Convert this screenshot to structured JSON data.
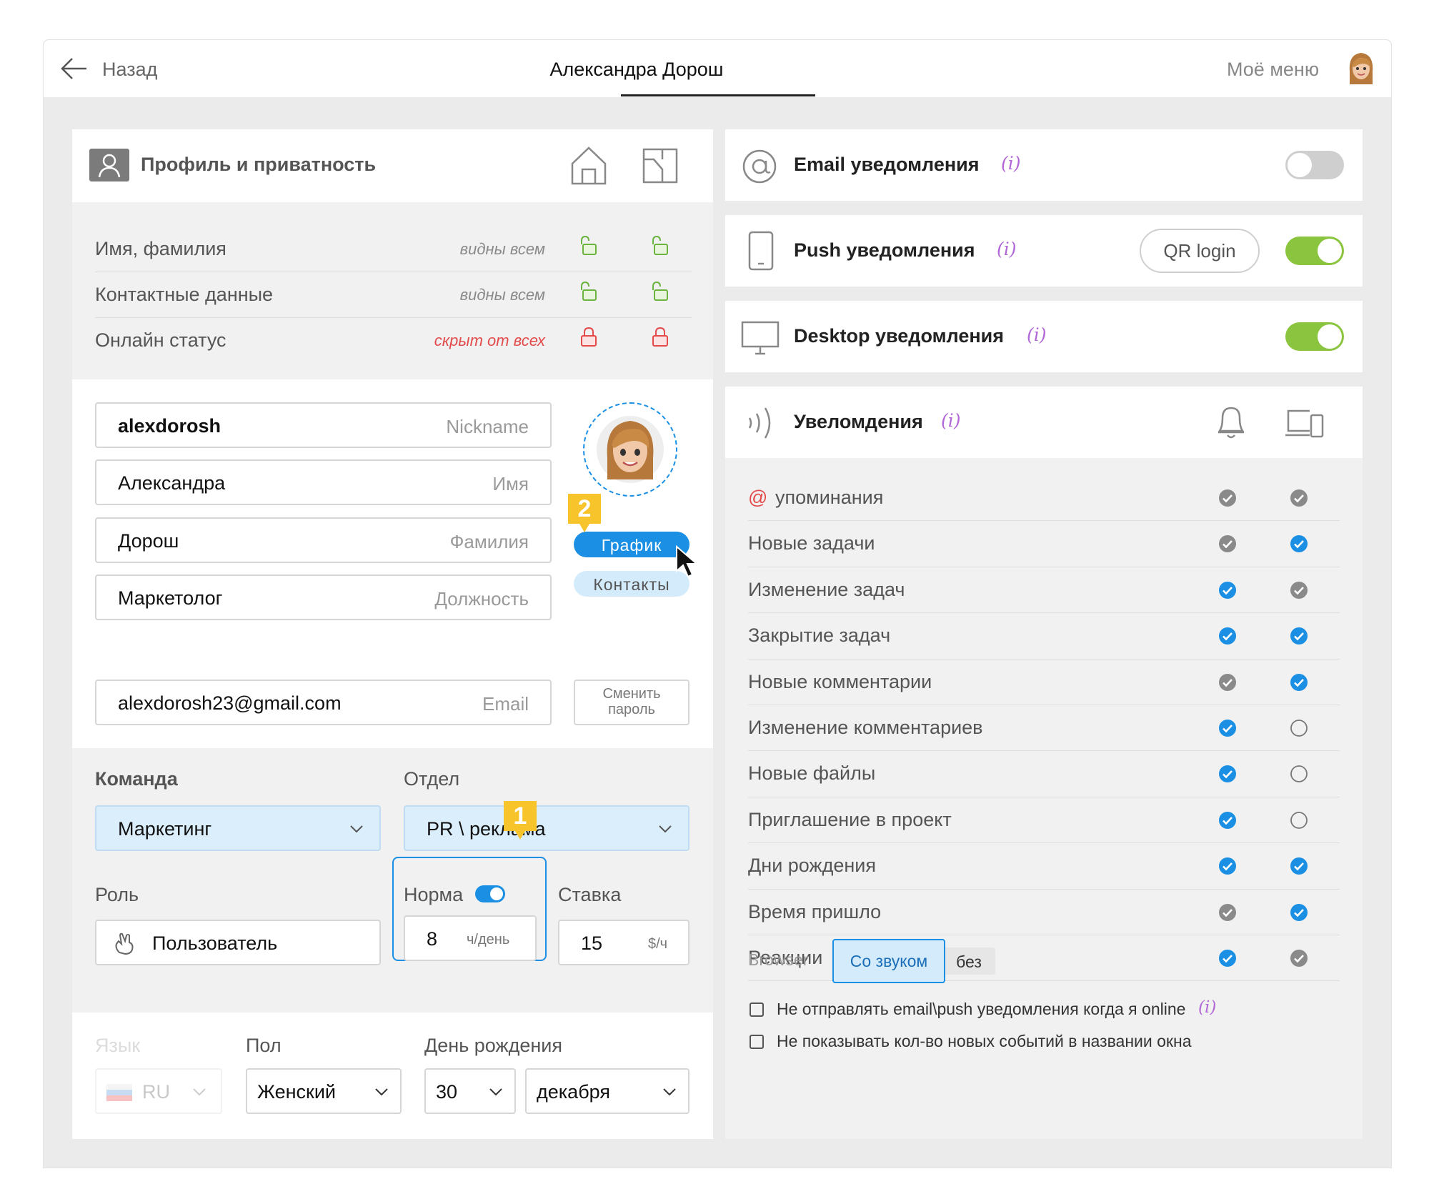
{
  "header": {
    "back_label": "Назад",
    "title": "Александра Дорош",
    "my_menu": "Моё меню"
  },
  "profile": {
    "title": "Профиль и приватность",
    "privacy_rows": [
      {
        "label": "Имя, фамилия",
        "status": "видны всем",
        "locked": false
      },
      {
        "label": "Контактные данные",
        "status": "видны всем",
        "locked": false
      },
      {
        "label": "Онлайн статус",
        "status": "скрыт от всех",
        "locked": true
      }
    ],
    "fields": {
      "nickname": {
        "value": "alexdorosh",
        "placeholder": "Nickname"
      },
      "first_name": {
        "value": "Александра",
        "placeholder": "Имя"
      },
      "last_name": {
        "value": "Дорош",
        "placeholder": "Фамилия"
      },
      "position": {
        "value": "Маркетолог",
        "placeholder": "Должность"
      },
      "email": {
        "value": "alexdorosh23@gmail.com",
        "placeholder": "Email"
      }
    },
    "schedule_label": "График",
    "contacts_label": "Контакты",
    "change_password_line1": "Сменить",
    "change_password_line2": "пароль",
    "badge1": "1",
    "badge2": "2"
  },
  "team": {
    "team_label": "Команда",
    "team_value": "Маркетинг",
    "dept_label": "Отдел",
    "dept_value": "PR \\ реклама",
    "role_label": "Роль",
    "role_value": "Пользователь",
    "norm_label": "Норма",
    "norm_on": true,
    "norm_value": "8",
    "norm_unit": "ч/день",
    "rate_label": "Ставка",
    "rate_value": "15",
    "rate_unit": "$/ч"
  },
  "personal": {
    "lang_label": "Язык",
    "lang_value": "RU",
    "gender_label": "Пол",
    "gender_value": "Женский",
    "birthday_label": "День рождения",
    "birthday_day": "30",
    "birthday_month": "декабря"
  },
  "channels": [
    {
      "title": "Email уведомления",
      "info": "(i)",
      "enabled": false
    },
    {
      "title": "Push уведомления",
      "info": "(i)",
      "enabled": true,
      "button": "QR login"
    },
    {
      "title": "Desktop уведомления",
      "info": "(i)",
      "enabled": true
    }
  ],
  "notifications": {
    "title": "Увеломдения",
    "info": "(i)",
    "rows": [
      {
        "label": "упоминания",
        "prefix": "@",
        "col1": "gray",
        "col2": "gray"
      },
      {
        "label": "Новые задачи",
        "col1": "gray",
        "col2": "blue"
      },
      {
        "label": "Изменение задач",
        "col1": "blue",
        "col2": "gray"
      },
      {
        "label": "Закрытие задач",
        "col1": "blue",
        "col2": "blue"
      },
      {
        "label": "Новые комментарии",
        "col1": "gray",
        "col2": "blue"
      },
      {
        "label": "Изменение комментариев",
        "col1": "blue",
        "col2": "empty"
      },
      {
        "label": "Новые файлы",
        "col1": "blue",
        "col2": "empty"
      },
      {
        "label": "Приглашение в проект",
        "col1": "blue",
        "col2": "empty"
      },
      {
        "label": "Дни рождения",
        "col1": "blue",
        "col2": "blue"
      },
      {
        "label": "Время пришло",
        "col1": "gray",
        "col2": "blue"
      },
      {
        "label": "Реакции",
        "col1": "blue",
        "col2": "gray"
      }
    ],
    "browser_label": "Browser",
    "sound_on": "Со звуком",
    "sound_off": "без",
    "option1": "Не отправлять email\\push уведомления когда я online",
    "option1_info": "(i)",
    "option2": "Не показывать кол-во новых событий в названии окна"
  },
  "colors": {
    "accent_blue": "#1a8fe3",
    "toggle_green": "#8bc53f",
    "toggle_off": "#cfcfcf",
    "unlock_green": "#6cb33f",
    "lock_red": "#e34b4b",
    "badge_yellow": "#f7c52b",
    "info_purple": "#b267d6"
  }
}
